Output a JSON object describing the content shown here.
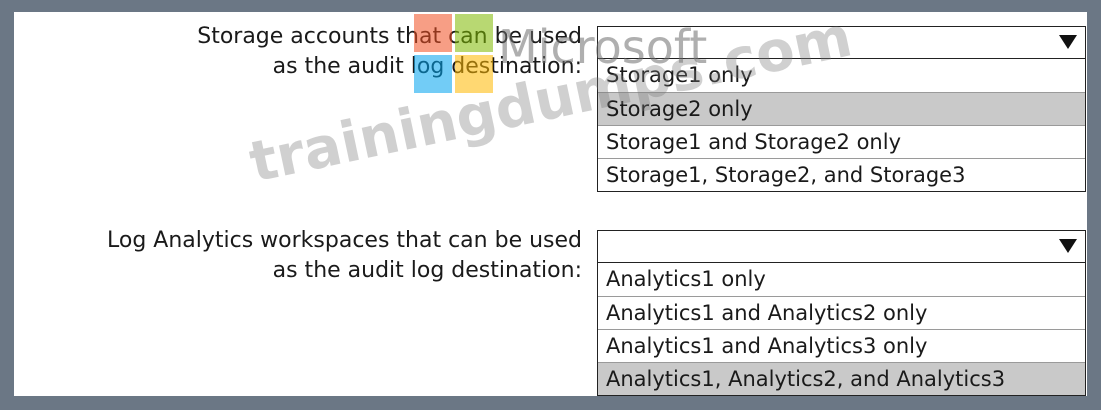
{
  "watermark": {
    "brand": "Microsoft",
    "site": "trainingdumps.com"
  },
  "questions": [
    {
      "label_line1": "Storage accounts that can be used",
      "label_line2": "as the audit log destination:",
      "selected_value": "",
      "options": [
        "Storage1 only",
        "Storage2 only",
        "Storage1 and Storage2 only",
        "Storage1, Storage2, and Storage3"
      ],
      "highlighted_option": "Storage2 only"
    },
    {
      "label_line1": "Log Analytics workspaces that can be used",
      "label_line2": "as the audit log destination:",
      "selected_value": "",
      "options": [
        "Analytics1 only",
        "Analytics1 and Analytics2 only",
        "Analytics1 and Analytics3 only",
        "Analytics1, Analytics2, and Analytics3"
      ],
      "highlighted_option": "Analytics1, Analytics2, and Analytics3"
    }
  ],
  "icons": {
    "dropdown_arrow": "triangle-down-icon"
  },
  "colors": {
    "frame_border": "#6b7785",
    "highlight": "#c9c9c9",
    "logo_red": "#f25022",
    "logo_green": "#7fba00",
    "logo_blue": "#00a4ef",
    "logo_yellow": "#ffb900"
  }
}
